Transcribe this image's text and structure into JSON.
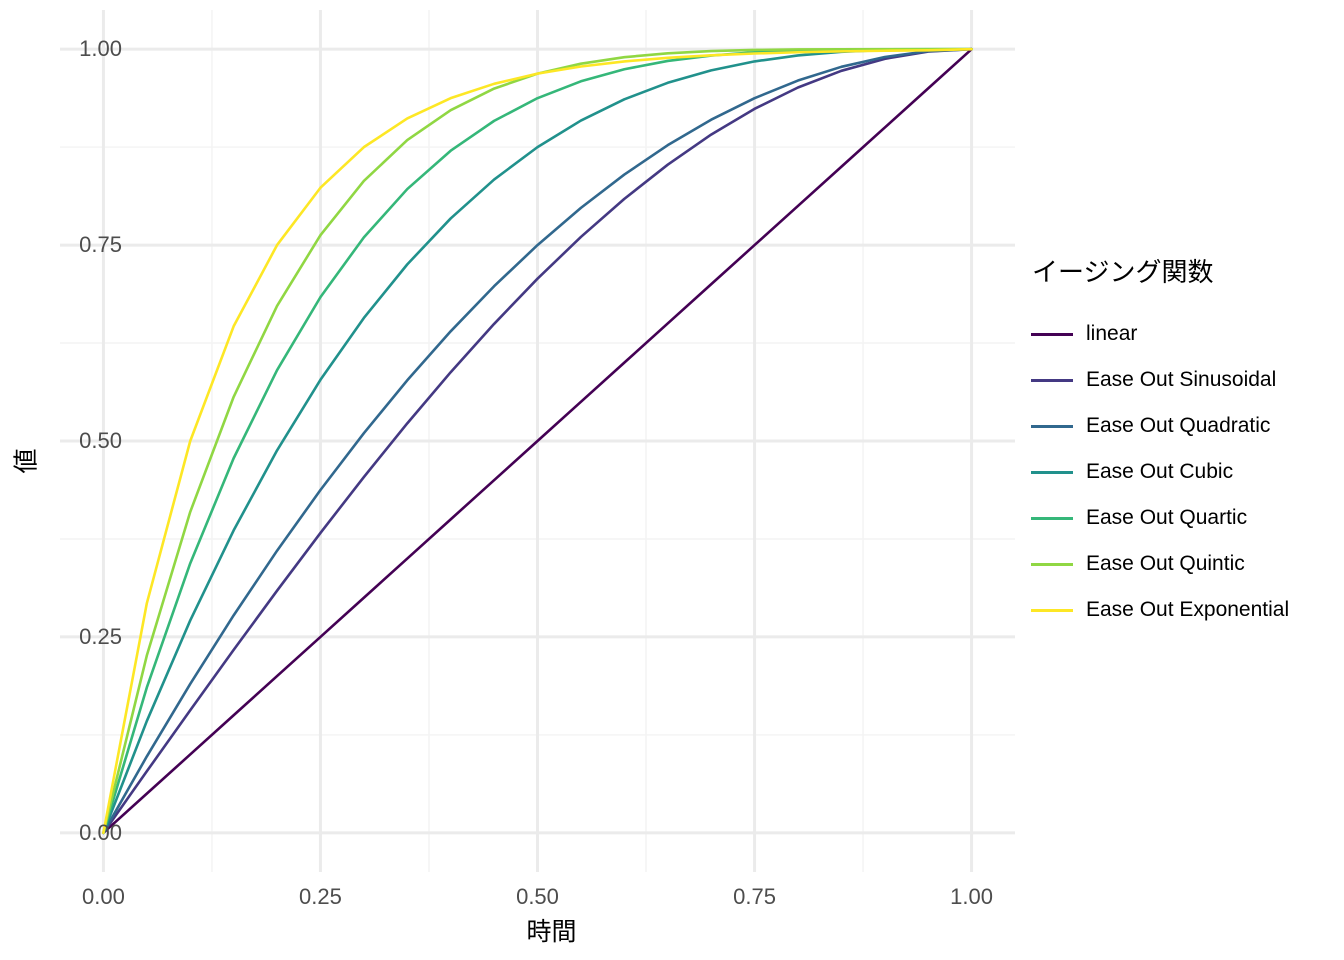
{
  "chart_data": {
    "type": "line",
    "title": "",
    "xlabel": "時間",
    "ylabel": "値",
    "xlim": [
      -0.05,
      1.05
    ],
    "ylim": [
      -0.05,
      1.05
    ],
    "grid": true,
    "legend_position": "right",
    "legend_title": "イージング関数",
    "x_ticks": [
      "0.00",
      "0.25",
      "0.50",
      "0.75",
      "1.00"
    ],
    "x_tick_values": [
      0.0,
      0.25,
      0.5,
      0.75,
      1.0
    ],
    "y_ticks": [
      "0.00",
      "0.25",
      "0.50",
      "0.75",
      "1.00"
    ],
    "y_tick_values": [
      0.0,
      0.25,
      0.5,
      0.75,
      1.0
    ],
    "x": [
      0.0,
      0.05,
      0.1,
      0.15,
      0.2,
      0.25,
      0.3,
      0.35,
      0.4,
      0.45,
      0.5,
      0.55,
      0.6,
      0.65,
      0.7,
      0.75,
      0.8,
      0.85,
      0.9,
      0.95,
      1.0
    ],
    "series": [
      {
        "name": "linear",
        "color": "#440154",
        "values": [
          0.0,
          0.05,
          0.1,
          0.15,
          0.2,
          0.25,
          0.3,
          0.35,
          0.4,
          0.45,
          0.5,
          0.55,
          0.6,
          0.65,
          0.7,
          0.75,
          0.8,
          0.85,
          0.9,
          0.95,
          1.0
        ]
      },
      {
        "name": "Ease Out Sinusoidal",
        "color": "#443983",
        "values": [
          0.0,
          0.0785,
          0.1564,
          0.2334,
          0.309,
          0.3827,
          0.454,
          0.5225,
          0.5878,
          0.6494,
          0.7071,
          0.7604,
          0.809,
          0.8526,
          0.891,
          0.9239,
          0.9511,
          0.9724,
          0.9877,
          0.9969,
          1.0
        ]
      },
      {
        "name": "Ease Out Quadratic",
        "color": "#31688e",
        "values": [
          0.0,
          0.0975,
          0.19,
          0.2775,
          0.36,
          0.4375,
          0.51,
          0.5775,
          0.64,
          0.6975,
          0.75,
          0.7975,
          0.84,
          0.8775,
          0.91,
          0.9375,
          0.96,
          0.9775,
          0.99,
          0.9975,
          1.0
        ]
      },
      {
        "name": "Ease Out Cubic",
        "color": "#21918c",
        "values": [
          0.0,
          0.1426,
          0.271,
          0.3859,
          0.488,
          0.5781,
          0.657,
          0.7254,
          0.784,
          0.8336,
          0.875,
          0.9089,
          0.936,
          0.9571,
          0.973,
          0.9844,
          0.992,
          0.9966,
          0.999,
          0.9999,
          1.0
        ]
      },
      {
        "name": "Ease Out Quartic",
        "color": "#35b779",
        "values": [
          0.0,
          0.1855,
          0.3439,
          0.478,
          0.5904,
          0.6836,
          0.7599,
          0.8215,
          0.8704,
          0.9085,
          0.9375,
          0.959,
          0.9744,
          0.985,
          0.9919,
          0.9961,
          0.9984,
          0.9995,
          0.9999,
          1.0,
          1.0
        ]
      },
      {
        "name": "Ease Out Quintic",
        "color": "#90d743",
        "values": [
          0.0,
          0.2262,
          0.4095,
          0.5563,
          0.6723,
          0.7627,
          0.8319,
          0.884,
          0.9222,
          0.9497,
          0.9688,
          0.9815,
          0.9898,
          0.9947,
          0.9976,
          0.999,
          0.9997,
          0.9999,
          1.0,
          1.0,
          1.0
        ]
      },
      {
        "name": "Ease Out Exponential",
        "color": "#fde725",
        "values": [
          0.0,
          0.2929,
          0.5,
          0.6464,
          0.75,
          0.8232,
          0.875,
          0.9116,
          0.9375,
          0.9558,
          0.9688,
          0.9779,
          0.9844,
          0.989,
          0.9922,
          0.9945,
          0.9961,
          0.9972,
          0.998,
          0.9986,
          1.0
        ]
      }
    ]
  },
  "theme": {
    "panel_background": "#ffffff",
    "grid_major_color": "#ebebeb",
    "grid_minor_color": "#f4f4f4",
    "axis_text_color": "#4d4d4d",
    "axis_title_color": "#000000",
    "legend_text_color": "#000000"
  }
}
